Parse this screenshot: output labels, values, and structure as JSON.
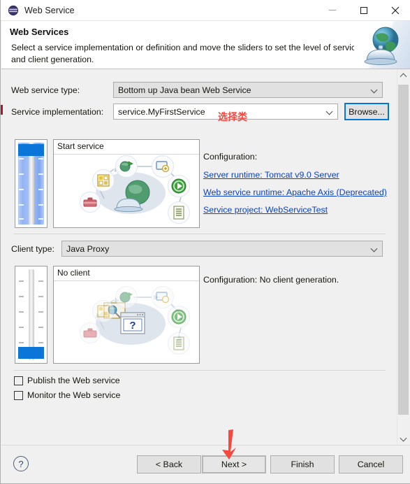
{
  "window": {
    "title": "Web Service",
    "icon": "web-service-sphere-icon",
    "controls": {
      "minimize": "minimize-icon",
      "maximize": "maximize-icon",
      "close": "close-icon"
    }
  },
  "header": {
    "title": "Web Services",
    "description": "Select a service implementation or definition and move the sliders to set the level of service and client generation.",
    "art_icon": "globe-bell-icon"
  },
  "form": {
    "service_type": {
      "label": "Web service type:",
      "value": "Bottom up Java bean Web Service"
    },
    "service_impl": {
      "label": "Service implementation:",
      "value": "service.MyFirstService",
      "browse_label": "Browse..."
    },
    "client_type": {
      "label": "Client type:",
      "value": "Java Proxy"
    }
  },
  "service_panel": {
    "caption": "Start service",
    "slider": {
      "fill_percent": 88,
      "thumb_position": "top"
    },
    "configuration": {
      "title": "Configuration:",
      "links": [
        "Server runtime: Tomcat v9.0 Server",
        "Web service runtime: Apache Axis (Deprecated)",
        "Service project: WebServiceTest"
      ]
    }
  },
  "client_panel": {
    "caption": "No client",
    "slider": {
      "fill_percent": 0,
      "thumb_position": "bottom"
    },
    "configuration": {
      "title": "Configuration: No client generation."
    }
  },
  "options": [
    {
      "label": "Publish the Web service",
      "checked": false
    },
    {
      "label": "Monitor the Web service",
      "checked": false
    }
  ],
  "scrollbar": {
    "up": "scroll-up-icon",
    "down": "scroll-down-icon"
  },
  "footer": {
    "help": "?",
    "buttons": [
      {
        "label": "< Back",
        "focused": false
      },
      {
        "label": "Next >",
        "focused": true
      },
      {
        "label": "Finish",
        "focused": false
      },
      {
        "label": "Cancel",
        "focused": false
      }
    ]
  },
  "annotations": {
    "select_class": "选择类",
    "arrow": "red-arrow-pointing-to-next"
  },
  "colors": {
    "link": "#0c41c4",
    "focus": "#0078d7",
    "slider_thumb": "#0b76d8",
    "annotation": "#f5483f"
  }
}
